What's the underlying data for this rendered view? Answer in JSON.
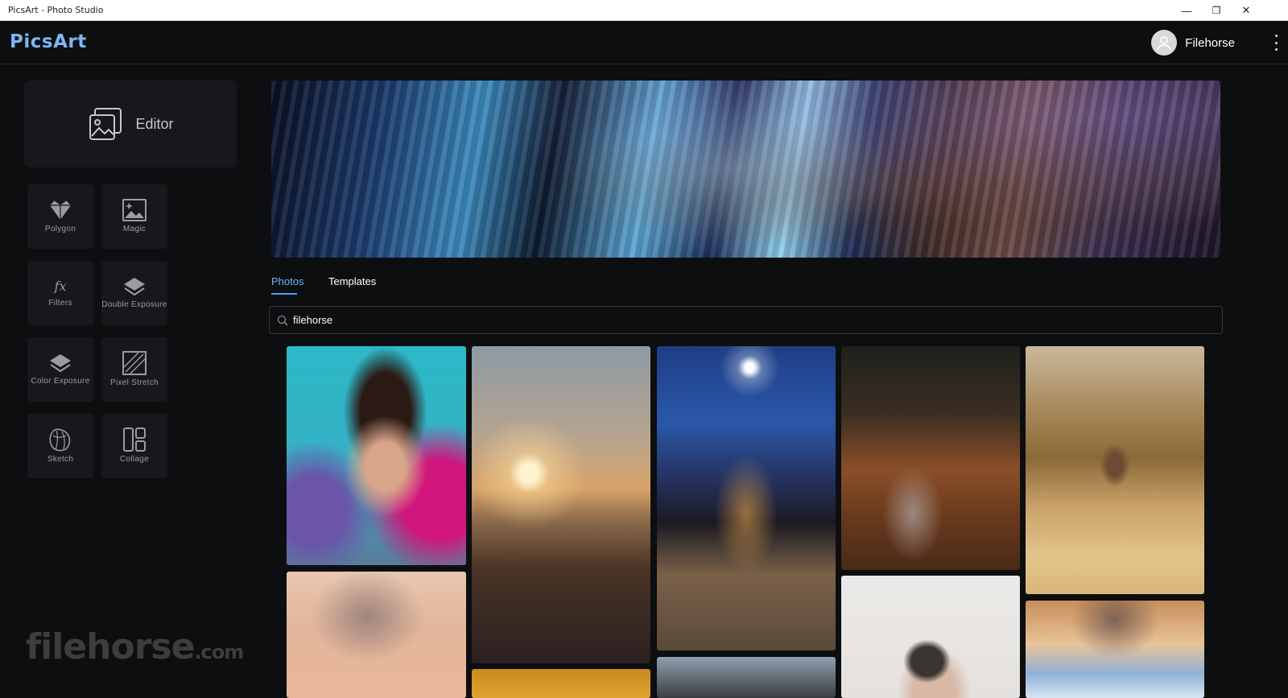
{
  "window": {
    "title": "PicsArt - Photo Studio",
    "minimize": "—",
    "restore": "❐",
    "close": "✕"
  },
  "header": {
    "logo": "PicsArt",
    "username": "Filehorse"
  },
  "sidebar": {
    "editor_label": "Editor",
    "tools": [
      {
        "label": "Polygon",
        "icon": "polygon-icon"
      },
      {
        "label": "Magic",
        "icon": "magic-icon"
      },
      {
        "label": "Filters",
        "icon": "fx-icon"
      },
      {
        "label": "Double Exposure",
        "icon": "layers-icon"
      },
      {
        "label": "Color Exposure",
        "icon": "layers-icon"
      },
      {
        "label": "Pixel Stretch",
        "icon": "pixel-stretch-icon"
      },
      {
        "label": "Sketch",
        "icon": "sketch-icon"
      },
      {
        "label": "Collage",
        "icon": "collage-icon"
      }
    ]
  },
  "main": {
    "tabs": [
      {
        "label": "Photos",
        "active": true
      },
      {
        "label": "Templates",
        "active": false
      }
    ],
    "search": {
      "value": "filehorse"
    }
  },
  "watermark": {
    "text": "filehorse",
    "suffix": ".com"
  },
  "colors": {
    "accent": "#4a9ff0",
    "logo": "#7fb6f2",
    "background": "#0d0e10",
    "card": "#16181b"
  }
}
